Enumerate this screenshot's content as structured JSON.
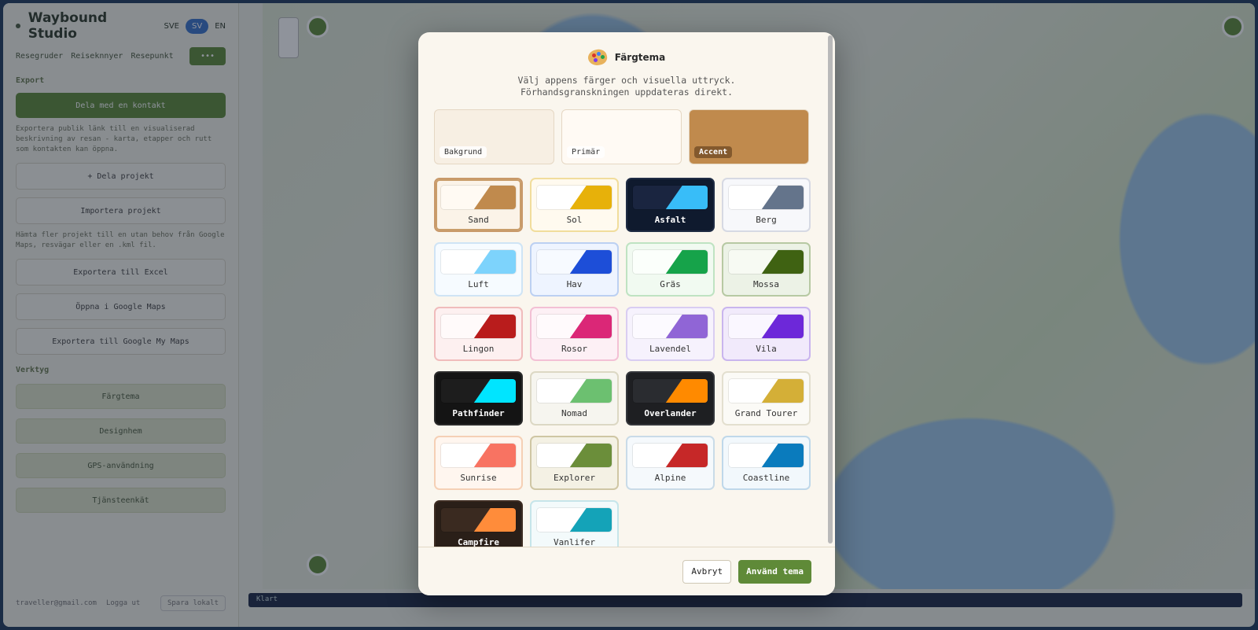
{
  "app": {
    "title": "Waybound Studio",
    "lang_left": "SVE",
    "lang_active": "SV",
    "lang_right": "EN",
    "tabs": [
      "Resegruder",
      "Reiseknnyer",
      "Resepunkt"
    ],
    "tab_action": "•••",
    "export_section": "Export",
    "export_button": "Dela med en kontakt",
    "export_note": "Exportera publik länk till en visualiserad beskrivning av resan - karta, etapper och rutt som kontakten kan öppna.",
    "buttons_plain": [
      "+ Dela projekt",
      "Importera projekt"
    ],
    "import_note": "Hämta fler projekt till en utan behov från Google Maps, resvägar eller en .kml fil.",
    "buttons_plain2": [
      "Exportera till Excel",
      "Öppna i Google Maps",
      "Exportera till Google My Maps"
    ],
    "tools_section": "Verktyg",
    "tool_buttons": [
      "Färgtema",
      "Designhem",
      "GPS-användning",
      "Tjänsteenkät"
    ],
    "footer_email": "traveller@gmail.com",
    "footer_link": "Logga ut",
    "footer_pill": "Spara lokalt",
    "statusbar": "Klart"
  },
  "modal": {
    "title": "Färgtema",
    "subtitle": "Välj appens färger och visuella uttryck. Förhandsgranskningen uppdateras direkt.",
    "preview": [
      {
        "label": "Bakgrund",
        "color": "#f7efe3"
      },
      {
        "label": "Primär",
        "color": "#fffaf4"
      },
      {
        "label": "Accent",
        "color": "#c08a4d"
      }
    ],
    "themes": [
      {
        "name": "Sand",
        "bg": "#fbf3e8",
        "border": "#c8996a",
        "primary": "#fffaf3",
        "accent": "#c08a4d",
        "text": "#333333",
        "selected": true
      },
      {
        "name": "Sol",
        "bg": "#fffaef",
        "border": "#f1dd9c",
        "primary": "#ffffff",
        "accent": "#e7b10a",
        "text": "#333333"
      },
      {
        "name": "Asfalt",
        "bg": "#0f1a2e",
        "border": "#1f2c44",
        "primary": "#1a2540",
        "accent": "#38bdf8",
        "text": "#ffffff"
      },
      {
        "name": "Berg",
        "bg": "#f7f8fb",
        "border": "#d6d9e3",
        "primary": "#ffffff",
        "accent": "#64748b",
        "text": "#333333"
      },
      {
        "name": "Luft",
        "bg": "#f6fbff",
        "border": "#cfe4f5",
        "primary": "#ffffff",
        "accent": "#7dd3fc",
        "text": "#333333"
      },
      {
        "name": "Hav",
        "bg": "#eef4ff",
        "border": "#bcd0f2",
        "primary": "#f7faff",
        "accent": "#1d4ed8",
        "text": "#333333"
      },
      {
        "name": "Gräs",
        "bg": "#f1faf1",
        "border": "#bfe3c2",
        "primary": "#fbfffb",
        "accent": "#16a34a",
        "text": "#333333"
      },
      {
        "name": "Mossa",
        "bg": "#ecf2e6",
        "border": "#b7c9a3",
        "primary": "#f7faf3",
        "accent": "#3f6212",
        "text": "#333333"
      },
      {
        "name": "Lingon",
        "bg": "#fdf0f0",
        "border": "#f0bcbc",
        "primary": "#fffafa",
        "accent": "#b91c1c",
        "text": "#333333"
      },
      {
        "name": "Rosor",
        "bg": "#fdf0f5",
        "border": "#f3c0d5",
        "primary": "#fffafc",
        "accent": "#db2777",
        "text": "#333333"
      },
      {
        "name": "Lavendel",
        "bg": "#f6f2fd",
        "border": "#d9cdf2",
        "primary": "#fcfaff",
        "accent": "#9065d6",
        "text": "#333333"
      },
      {
        "name": "Vila",
        "bg": "#f1eafb",
        "border": "#c9b5ee",
        "primary": "#faf7ff",
        "accent": "#6d28d9",
        "text": "#333333"
      },
      {
        "name": "Pathfinder",
        "bg": "#141414",
        "border": "#2a2a2a",
        "primary": "#1d1d1d",
        "accent": "#00e5ff",
        "text": "#ffffff"
      },
      {
        "name": "Nomad",
        "bg": "#f6f5ef",
        "border": "#dcd8c4",
        "primary": "#ffffff",
        "accent": "#6cc070",
        "text": "#333333"
      },
      {
        "name": "Overlander",
        "bg": "#1e1f22",
        "border": "#34363b",
        "primary": "#2a2c30",
        "accent": "#ff8a00",
        "text": "#ffffff"
      },
      {
        "name": "Grand Tourer",
        "bg": "#fbfaf6",
        "border": "#e3dfcf",
        "primary": "#ffffff",
        "accent": "#d4af37",
        "text": "#333333"
      },
      {
        "name": "Sunrise",
        "bg": "#fff6ef",
        "border": "#f5d0b5",
        "primary": "#ffffff",
        "accent": "#f87362",
        "text": "#333333"
      },
      {
        "name": "Explorer",
        "bg": "#f4f1e4",
        "border": "#cfc6a4",
        "primary": "#ffffff",
        "accent": "#6b8e3a",
        "text": "#333333"
      },
      {
        "name": "Alpine",
        "bg": "#f5f9fc",
        "border": "#c9dbe8",
        "primary": "#ffffff",
        "accent": "#c62828",
        "text": "#333333"
      },
      {
        "name": "Coastline",
        "bg": "#f2f8fc",
        "border": "#bfd8ea",
        "primary": "#ffffff",
        "accent": "#0a7bbd",
        "text": "#333333"
      },
      {
        "name": "Campfire",
        "bg": "#2a1f18",
        "border": "#3d2c22",
        "primary": "#3a2a20",
        "accent": "#ff8c3a",
        "text": "#ffffff"
      },
      {
        "name": "Vanlifer",
        "bg": "#f3fafb",
        "border": "#c6e5ea",
        "primary": "#ffffff",
        "accent": "#14a3b8",
        "text": "#333333"
      }
    ],
    "cancel": "Avbryt",
    "apply": "Använd tema"
  }
}
